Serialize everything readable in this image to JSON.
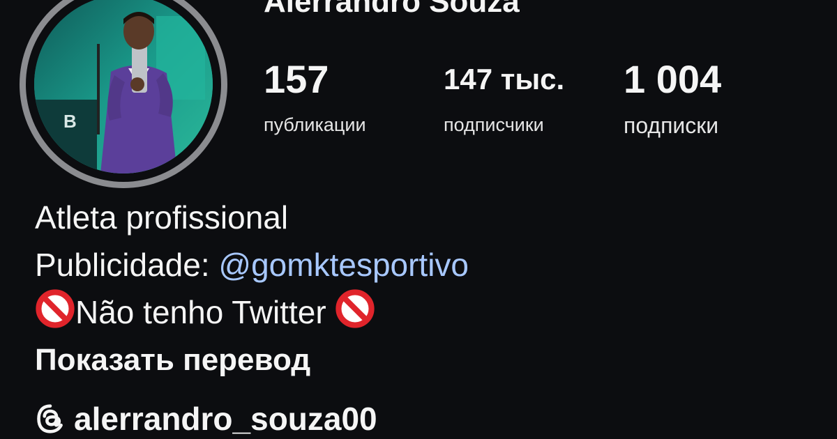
{
  "profile": {
    "username": "Alerrandro Souza",
    "avatar_icon": "profile-photo"
  },
  "stats": {
    "posts": {
      "value": "157",
      "label": "публикации"
    },
    "followers": {
      "value": "147 тыс.",
      "label": "подписчики"
    },
    "following": {
      "value": "1 004",
      "label": "подписки"
    }
  },
  "bio": {
    "line1": "Atleta profissional",
    "line2_prefix": "Publicidade: ",
    "line2_mention": "@gomktesportivo",
    "line3_text": "Não tenho Twitter",
    "line3_icon": "prohibited-emoji",
    "translate_label": "Показать перевод"
  },
  "threads": {
    "icon": "threads-icon",
    "handle": "alerrandro_souza00"
  },
  "colors": {
    "background": "#0c0d10",
    "text": "#f5f5f5",
    "mention": "#a8c8ff",
    "avatar_ring": "#8b8c90",
    "prohibited": "#e0242b"
  }
}
